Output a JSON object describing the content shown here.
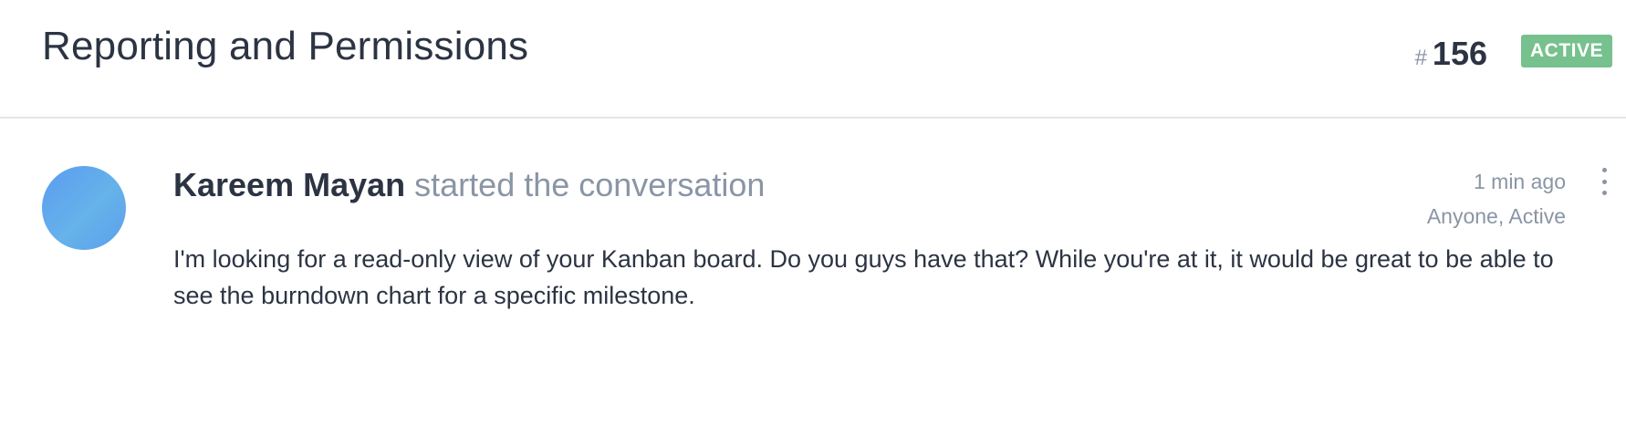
{
  "header": {
    "title": "Reporting and Permissions",
    "ticket_hash": "#",
    "ticket_number": "156",
    "status": "ACTIVE"
  },
  "conversation": {
    "author": "Kareem Mayan",
    "action": "started the conversation",
    "time": "1 min ago",
    "tags": "Anyone, Active",
    "message": "I'm looking for a read-only view of your Kanban board. Do you guys have that? While you're at it, it would be great to be able to see the burndown chart for a specific milestone.",
    "more_icon": "more-vertical-icon"
  },
  "colors": {
    "status_badge": "#76c18d",
    "avatar": "#5a9cf0",
    "text_primary": "#2c3443",
    "text_muted": "#8a95a5"
  }
}
